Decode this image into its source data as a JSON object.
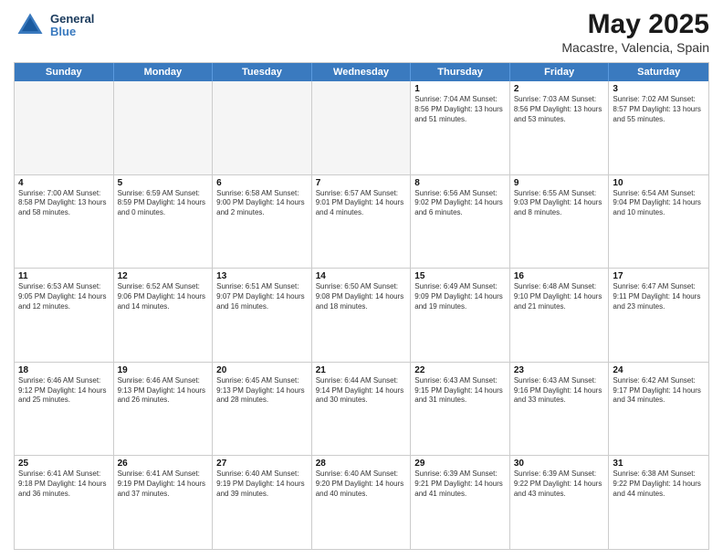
{
  "header": {
    "logo_line1": "General",
    "logo_line2": "Blue",
    "main_title": "May 2025",
    "subtitle": "Macastre, Valencia, Spain"
  },
  "days_of_week": [
    "Sunday",
    "Monday",
    "Tuesday",
    "Wednesday",
    "Thursday",
    "Friday",
    "Saturday"
  ],
  "weeks": [
    [
      {
        "day": "",
        "info": "",
        "empty": true
      },
      {
        "day": "",
        "info": "",
        "empty": true
      },
      {
        "day": "",
        "info": "",
        "empty": true
      },
      {
        "day": "",
        "info": "",
        "empty": true
      },
      {
        "day": "1",
        "info": "Sunrise: 7:04 AM\nSunset: 8:56 PM\nDaylight: 13 hours\nand 51 minutes.",
        "empty": false
      },
      {
        "day": "2",
        "info": "Sunrise: 7:03 AM\nSunset: 8:56 PM\nDaylight: 13 hours\nand 53 minutes.",
        "empty": false
      },
      {
        "day": "3",
        "info": "Sunrise: 7:02 AM\nSunset: 8:57 PM\nDaylight: 13 hours\nand 55 minutes.",
        "empty": false
      }
    ],
    [
      {
        "day": "4",
        "info": "Sunrise: 7:00 AM\nSunset: 8:58 PM\nDaylight: 13 hours\nand 58 minutes.",
        "empty": false
      },
      {
        "day": "5",
        "info": "Sunrise: 6:59 AM\nSunset: 8:59 PM\nDaylight: 14 hours\nand 0 minutes.",
        "empty": false
      },
      {
        "day": "6",
        "info": "Sunrise: 6:58 AM\nSunset: 9:00 PM\nDaylight: 14 hours\nand 2 minutes.",
        "empty": false
      },
      {
        "day": "7",
        "info": "Sunrise: 6:57 AM\nSunset: 9:01 PM\nDaylight: 14 hours\nand 4 minutes.",
        "empty": false
      },
      {
        "day": "8",
        "info": "Sunrise: 6:56 AM\nSunset: 9:02 PM\nDaylight: 14 hours\nand 6 minutes.",
        "empty": false
      },
      {
        "day": "9",
        "info": "Sunrise: 6:55 AM\nSunset: 9:03 PM\nDaylight: 14 hours\nand 8 minutes.",
        "empty": false
      },
      {
        "day": "10",
        "info": "Sunrise: 6:54 AM\nSunset: 9:04 PM\nDaylight: 14 hours\nand 10 minutes.",
        "empty": false
      }
    ],
    [
      {
        "day": "11",
        "info": "Sunrise: 6:53 AM\nSunset: 9:05 PM\nDaylight: 14 hours\nand 12 minutes.",
        "empty": false
      },
      {
        "day": "12",
        "info": "Sunrise: 6:52 AM\nSunset: 9:06 PM\nDaylight: 14 hours\nand 14 minutes.",
        "empty": false
      },
      {
        "day": "13",
        "info": "Sunrise: 6:51 AM\nSunset: 9:07 PM\nDaylight: 14 hours\nand 16 minutes.",
        "empty": false
      },
      {
        "day": "14",
        "info": "Sunrise: 6:50 AM\nSunset: 9:08 PM\nDaylight: 14 hours\nand 18 minutes.",
        "empty": false
      },
      {
        "day": "15",
        "info": "Sunrise: 6:49 AM\nSunset: 9:09 PM\nDaylight: 14 hours\nand 19 minutes.",
        "empty": false
      },
      {
        "day": "16",
        "info": "Sunrise: 6:48 AM\nSunset: 9:10 PM\nDaylight: 14 hours\nand 21 minutes.",
        "empty": false
      },
      {
        "day": "17",
        "info": "Sunrise: 6:47 AM\nSunset: 9:11 PM\nDaylight: 14 hours\nand 23 minutes.",
        "empty": false
      }
    ],
    [
      {
        "day": "18",
        "info": "Sunrise: 6:46 AM\nSunset: 9:12 PM\nDaylight: 14 hours\nand 25 minutes.",
        "empty": false
      },
      {
        "day": "19",
        "info": "Sunrise: 6:46 AM\nSunset: 9:13 PM\nDaylight: 14 hours\nand 26 minutes.",
        "empty": false
      },
      {
        "day": "20",
        "info": "Sunrise: 6:45 AM\nSunset: 9:13 PM\nDaylight: 14 hours\nand 28 minutes.",
        "empty": false
      },
      {
        "day": "21",
        "info": "Sunrise: 6:44 AM\nSunset: 9:14 PM\nDaylight: 14 hours\nand 30 minutes.",
        "empty": false
      },
      {
        "day": "22",
        "info": "Sunrise: 6:43 AM\nSunset: 9:15 PM\nDaylight: 14 hours\nand 31 minutes.",
        "empty": false
      },
      {
        "day": "23",
        "info": "Sunrise: 6:43 AM\nSunset: 9:16 PM\nDaylight: 14 hours\nand 33 minutes.",
        "empty": false
      },
      {
        "day": "24",
        "info": "Sunrise: 6:42 AM\nSunset: 9:17 PM\nDaylight: 14 hours\nand 34 minutes.",
        "empty": false
      }
    ],
    [
      {
        "day": "25",
        "info": "Sunrise: 6:41 AM\nSunset: 9:18 PM\nDaylight: 14 hours\nand 36 minutes.",
        "empty": false
      },
      {
        "day": "26",
        "info": "Sunrise: 6:41 AM\nSunset: 9:19 PM\nDaylight: 14 hours\nand 37 minutes.",
        "empty": false
      },
      {
        "day": "27",
        "info": "Sunrise: 6:40 AM\nSunset: 9:19 PM\nDaylight: 14 hours\nand 39 minutes.",
        "empty": false
      },
      {
        "day": "28",
        "info": "Sunrise: 6:40 AM\nSunset: 9:20 PM\nDaylight: 14 hours\nand 40 minutes.",
        "empty": false
      },
      {
        "day": "29",
        "info": "Sunrise: 6:39 AM\nSunset: 9:21 PM\nDaylight: 14 hours\nand 41 minutes.",
        "empty": false
      },
      {
        "day": "30",
        "info": "Sunrise: 6:39 AM\nSunset: 9:22 PM\nDaylight: 14 hours\nand 43 minutes.",
        "empty": false
      },
      {
        "day": "31",
        "info": "Sunrise: 6:38 AM\nSunset: 9:22 PM\nDaylight: 14 hours\nand 44 minutes.",
        "empty": false
      }
    ]
  ]
}
